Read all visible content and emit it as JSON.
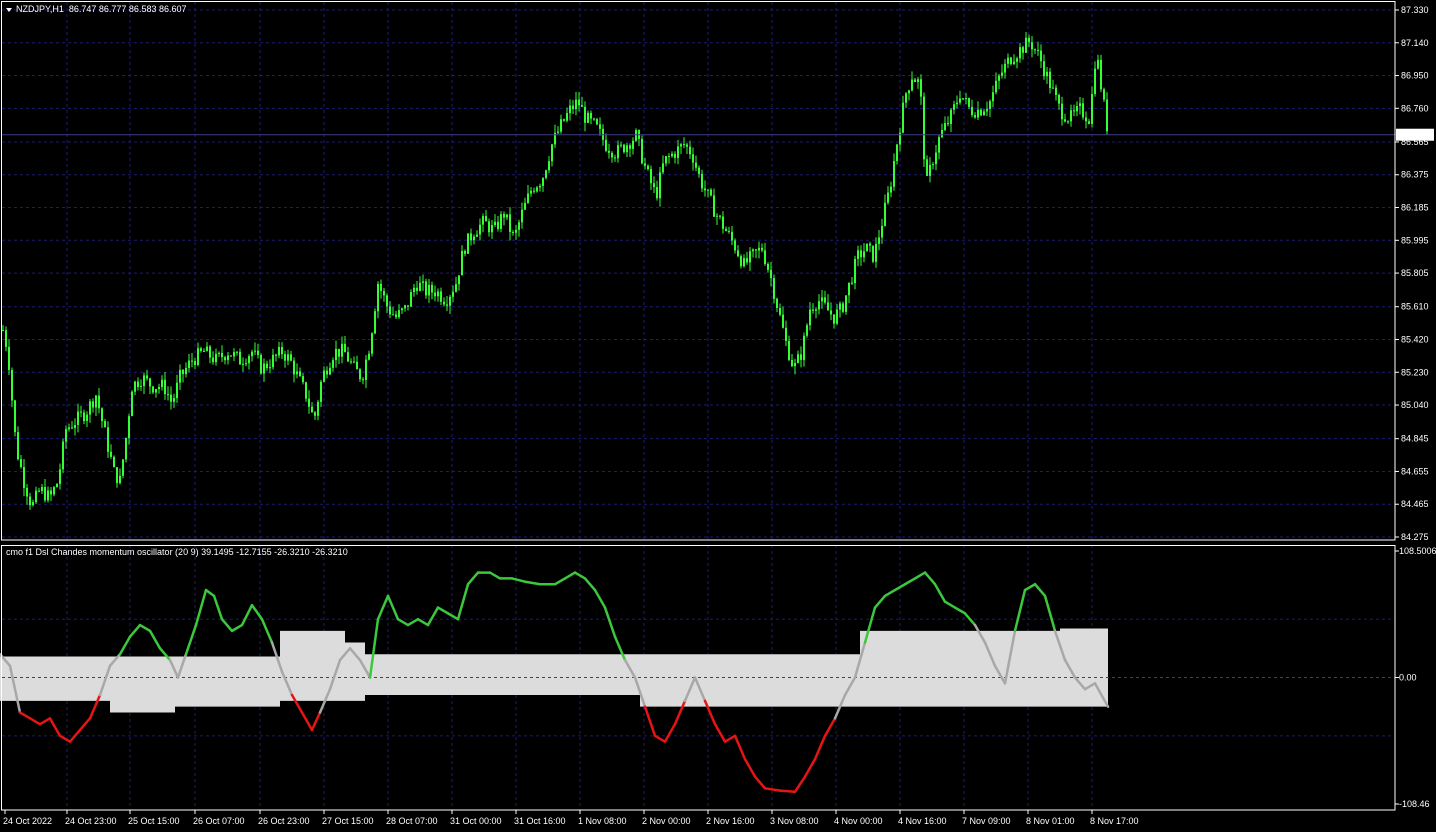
{
  "symbol_header": {
    "symbol": "NZDJPY,H1",
    "ohlc": "86.747 86.777 86.583 86.607"
  },
  "indicator_header": {
    "text": "cmo f1 Dsl Chandes momentum oscillator (20 9) 39.1495 -12.7155 -26.3210 -26.3210"
  },
  "price_axis": {
    "ticks": [
      "87.330",
      "87.140",
      "86.950",
      "86.760",
      "86.565",
      "86.375",
      "86.185",
      "85.995",
      "85.805",
      "85.610",
      "85.420",
      "85.230",
      "85.040",
      "84.845",
      "84.655",
      "84.465",
      "84.275"
    ],
    "current_price": "86.607"
  },
  "indicator_axis": {
    "ticks": [
      "108.5006",
      "0.00",
      "-108.46"
    ]
  },
  "time_axis": {
    "ticks": [
      "24 Oct 2022",
      "24 Oct 23:00",
      "25 Oct 15:00",
      "26 Oct 07:00",
      "26 Oct 23:00",
      "27 Oct 15:00",
      "28 Oct 07:00",
      "31 Oct 00:00",
      "31 Oct 16:00",
      "1 Nov 08:00",
      "2 Nov 00:00",
      "2 Nov 16:00",
      "3 Nov 08:00",
      "4 Nov 00:00",
      "4 Nov 16:00",
      "7 Nov 09:00",
      "8 Nov 01:00",
      "8 Nov 17:00"
    ]
  },
  "colors": {
    "background": "#000000",
    "grid": "#1c1c6e",
    "candle": "#33ff33",
    "current_price_line": "#3c3c8c",
    "band": "#dcdcdc",
    "osc_neutral": "#a8a8a8",
    "osc_up": "#3cc83c",
    "osc_down": "#e61414",
    "text": "#ffffff"
  },
  "price_path": [
    [
      0,
      85.55
    ],
    [
      8,
      85.35
    ],
    [
      16,
      84.8
    ],
    [
      24,
      84.6
    ],
    [
      32,
      84.45
    ],
    [
      40,
      84.55
    ],
    [
      50,
      84.5
    ],
    [
      58,
      84.6
    ],
    [
      66,
      84.9
    ],
    [
      76,
      84.95
    ],
    [
      86,
      85.0
    ],
    [
      96,
      85.1
    ],
    [
      106,
      84.85
    ],
    [
      114,
      84.65
    ],
    [
      120,
      84.6
    ],
    [
      126,
      84.85
    ],
    [
      132,
      85.15
    ],
    [
      142,
      85.2
    ],
    [
      152,
      85.15
    ],
    [
      164,
      85.15
    ],
    [
      172,
      85.05
    ],
    [
      180,
      85.2
    ],
    [
      192,
      85.3
    ],
    [
      204,
      85.35
    ],
    [
      216,
      85.3
    ],
    [
      228,
      85.35
    ],
    [
      240,
      85.3
    ],
    [
      252,
      85.35
    ],
    [
      262,
      85.25
    ],
    [
      272,
      85.3
    ],
    [
      282,
      85.35
    ],
    [
      290,
      85.3
    ],
    [
      298,
      85.2
    ],
    [
      306,
      85.1
    ],
    [
      314,
      84.95
    ],
    [
      322,
      85.2
    ],
    [
      334,
      85.35
    ],
    [
      344,
      85.35
    ],
    [
      354,
      85.25
    ],
    [
      362,
      85.2
    ],
    [
      370,
      85.4
    ],
    [
      378,
      85.75
    ],
    [
      388,
      85.6
    ],
    [
      396,
      85.55
    ],
    [
      406,
      85.6
    ],
    [
      416,
      85.75
    ],
    [
      426,
      85.7
    ],
    [
      436,
      85.7
    ],
    [
      446,
      85.65
    ],
    [
      456,
      85.75
    ],
    [
      464,
      85.95
    ],
    [
      474,
      86.05
    ],
    [
      484,
      86.1
    ],
    [
      494,
      86.05
    ],
    [
      504,
      86.15
    ],
    [
      514,
      86.0
    ],
    [
      522,
      86.15
    ],
    [
      532,
      86.3
    ],
    [
      542,
      86.35
    ],
    [
      552,
      86.55
    ],
    [
      560,
      86.65
    ],
    [
      570,
      86.75
    ],
    [
      578,
      86.8
    ],
    [
      586,
      86.7
    ],
    [
      596,
      86.65
    ],
    [
      606,
      86.55
    ],
    [
      616,
      86.5
    ],
    [
      626,
      86.55
    ],
    [
      636,
      86.6
    ],
    [
      646,
      86.4
    ],
    [
      656,
      86.25
    ],
    [
      664,
      86.45
    ],
    [
      674,
      86.5
    ],
    [
      684,
      86.55
    ],
    [
      692,
      86.5
    ],
    [
      700,
      86.35
    ],
    [
      708,
      86.25
    ],
    [
      716,
      86.15
    ],
    [
      726,
      86.05
    ],
    [
      736,
      85.95
    ],
    [
      744,
      85.85
    ],
    [
      752,
      85.9
    ],
    [
      762,
      85.95
    ],
    [
      770,
      85.8
    ],
    [
      778,
      85.6
    ],
    [
      786,
      85.4
    ],
    [
      794,
      85.25
    ],
    [
      802,
      85.35
    ],
    [
      810,
      85.6
    ],
    [
      818,
      85.65
    ],
    [
      826,
      85.6
    ],
    [
      834,
      85.55
    ],
    [
      842,
      85.6
    ],
    [
      850,
      85.75
    ],
    [
      858,
      85.9
    ],
    [
      866,
      85.95
    ],
    [
      874,
      85.9
    ],
    [
      882,
      86.1
    ],
    [
      890,
      86.3
    ],
    [
      898,
      86.6
    ],
    [
      906,
      86.85
    ],
    [
      912,
      86.95
    ],
    [
      920,
      86.9
    ],
    [
      926,
      86.3
    ],
    [
      932,
      86.45
    ],
    [
      940,
      86.6
    ],
    [
      950,
      86.7
    ],
    [
      960,
      86.85
    ],
    [
      970,
      86.75
    ],
    [
      980,
      86.75
    ],
    [
      990,
      86.8
    ],
    [
      1000,
      86.95
    ],
    [
      1010,
      87.05
    ],
    [
      1020,
      87.1
    ],
    [
      1030,
      87.15
    ],
    [
      1040,
      87.05
    ],
    [
      1050,
      86.9
    ],
    [
      1060,
      86.75
    ],
    [
      1070,
      86.7
    ],
    [
      1080,
      86.75
    ],
    [
      1090,
      86.7
    ],
    [
      1096,
      87.1
    ],
    [
      1102,
      86.85
    ],
    [
      1108,
      86.62
    ]
  ],
  "oscillator_path": [
    [
      0,
      20
    ],
    [
      10,
      10
    ],
    [
      20,
      -30
    ],
    [
      30,
      -35
    ],
    [
      40,
      -40
    ],
    [
      50,
      -35
    ],
    [
      60,
      -50
    ],
    [
      70,
      -55
    ],
    [
      80,
      -45
    ],
    [
      90,
      -35
    ],
    [
      100,
      -15
    ],
    [
      110,
      10
    ],
    [
      120,
      20
    ],
    [
      130,
      35
    ],
    [
      140,
      45
    ],
    [
      150,
      40
    ],
    [
      160,
      25
    ],
    [
      170,
      15
    ],
    [
      178,
      0
    ],
    [
      186,
      20
    ],
    [
      196,
      45
    ],
    [
      206,
      75
    ],
    [
      214,
      70
    ],
    [
      222,
      50
    ],
    [
      232,
      40
    ],
    [
      242,
      45
    ],
    [
      252,
      62
    ],
    [
      262,
      50
    ],
    [
      272,
      30
    ],
    [
      282,
      5
    ],
    [
      292,
      -15
    ],
    [
      302,
      -30
    ],
    [
      312,
      -45
    ],
    [
      320,
      -30
    ],
    [
      330,
      -10
    ],
    [
      340,
      15
    ],
    [
      350,
      25
    ],
    [
      360,
      15
    ],
    [
      370,
      0
    ],
    [
      378,
      50
    ],
    [
      388,
      70
    ],
    [
      398,
      50
    ],
    [
      408,
      45
    ],
    [
      418,
      50
    ],
    [
      428,
      45
    ],
    [
      438,
      60
    ],
    [
      448,
      55
    ],
    [
      458,
      50
    ],
    [
      468,
      80
    ],
    [
      478,
      90
    ],
    [
      490,
      90
    ],
    [
      500,
      85
    ],
    [
      512,
      85
    ],
    [
      526,
      82
    ],
    [
      540,
      80
    ],
    [
      555,
      80
    ],
    [
      565,
      85
    ],
    [
      575,
      90
    ],
    [
      585,
      85
    ],
    [
      595,
      75
    ],
    [
      605,
      60
    ],
    [
      615,
      35
    ],
    [
      625,
      15
    ],
    [
      635,
      0
    ],
    [
      645,
      -25
    ],
    [
      655,
      -50
    ],
    [
      665,
      -55
    ],
    [
      675,
      -40
    ],
    [
      685,
      -20
    ],
    [
      695,
      0
    ],
    [
      705,
      -20
    ],
    [
      715,
      -40
    ],
    [
      725,
      -55
    ],
    [
      735,
      -50
    ],
    [
      745,
      -70
    ],
    [
      755,
      -85
    ],
    [
      765,
      -95
    ],
    [
      780,
      -97
    ],
    [
      795,
      -98
    ],
    [
      805,
      -85
    ],
    [
      815,
      -70
    ],
    [
      825,
      -50
    ],
    [
      835,
      -35
    ],
    [
      845,
      -15
    ],
    [
      855,
      0
    ],
    [
      865,
      30
    ],
    [
      875,
      60
    ],
    [
      885,
      70
    ],
    [
      895,
      75
    ],
    [
      905,
      80
    ],
    [
      915,
      85
    ],
    [
      925,
      90
    ],
    [
      935,
      80
    ],
    [
      945,
      65
    ],
    [
      955,
      60
    ],
    [
      965,
      55
    ],
    [
      975,
      45
    ],
    [
      985,
      30
    ],
    [
      995,
      10
    ],
    [
      1005,
      -5
    ],
    [
      1015,
      40
    ],
    [
      1025,
      75
    ],
    [
      1035,
      80
    ],
    [
      1045,
      70
    ],
    [
      1055,
      40
    ],
    [
      1065,
      15
    ],
    [
      1075,
      0
    ],
    [
      1085,
      -10
    ],
    [
      1095,
      -5
    ],
    [
      1108,
      -25
    ]
  ],
  "band_steps": [
    [
      0,
      18,
      -20
    ],
    [
      110,
      18,
      -30
    ],
    [
      175,
      18,
      -25
    ],
    [
      280,
      40,
      -20
    ],
    [
      345,
      30,
      -20
    ],
    [
      365,
      20,
      -15
    ],
    [
      640,
      20,
      -25
    ],
    [
      860,
      40,
      -25
    ],
    [
      1060,
      42,
      -25
    ],
    [
      1108,
      42,
      -25
    ]
  ]
}
